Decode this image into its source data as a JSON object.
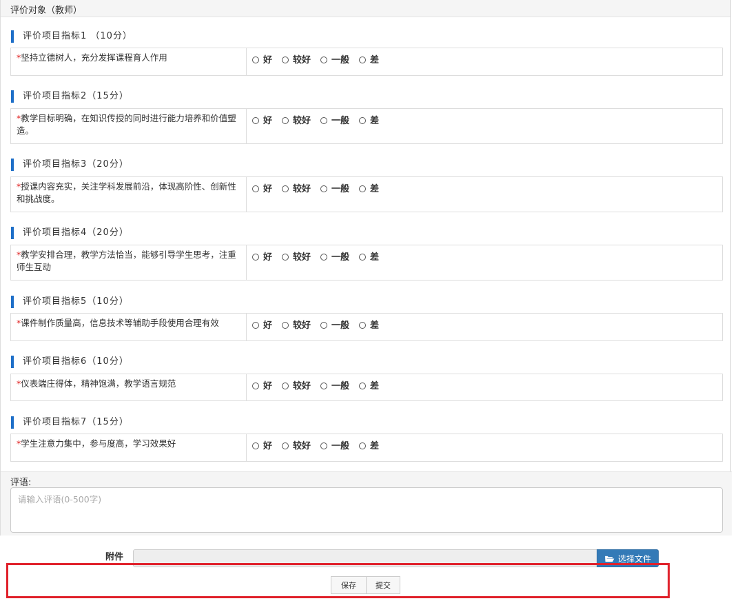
{
  "header": {
    "title": "评价对象（教师）"
  },
  "sections": [
    {
      "title": "评价项目指标1 （10分）",
      "required": "*",
      "desc": "坚持立德树人，充分发挥课程育人作用"
    },
    {
      "title": "评价项目指标2（15分）",
      "required": "*",
      "desc": "教学目标明确，在知识传授的同时进行能力培养和价值塑造。"
    },
    {
      "title": "评价项目指标3（20分）",
      "required": "*",
      "desc": "授课内容充实，关注学科发展前沿，体现高阶性、创新性和挑战度。"
    },
    {
      "title": "评价项目指标4（20分）",
      "required": "*",
      "desc": "教学安排合理，教学方法恰当，能够引导学生思考，注重师生互动"
    },
    {
      "title": "评价项目指标5（10分）",
      "required": "*",
      "desc": "课件制作质量高，信息技术等辅助手段使用合理有效"
    },
    {
      "title": "评价项目指标6（10分）",
      "required": "*",
      "desc": "仪表端庄得体，精神饱满，教学语言规范"
    },
    {
      "title": "评价项目指标7（15分）",
      "required": "*",
      "desc": "学生注意力集中，参与度高，学习效果好"
    }
  ],
  "options": [
    "好",
    "较好",
    "一般",
    "差"
  ],
  "comment": {
    "label": "评语:",
    "placeholder": "请输入评语(0-500字)"
  },
  "attachment": {
    "label": "附件",
    "button_label": "选择文件",
    "icon": "folder-open-icon"
  },
  "actions": {
    "save_label": "保存",
    "submit_label": "提交"
  },
  "colors": {
    "accent": "#1e6fc8",
    "primary_button": "#337ab7",
    "required": "#e02020",
    "highlight": "#e0202a"
  }
}
